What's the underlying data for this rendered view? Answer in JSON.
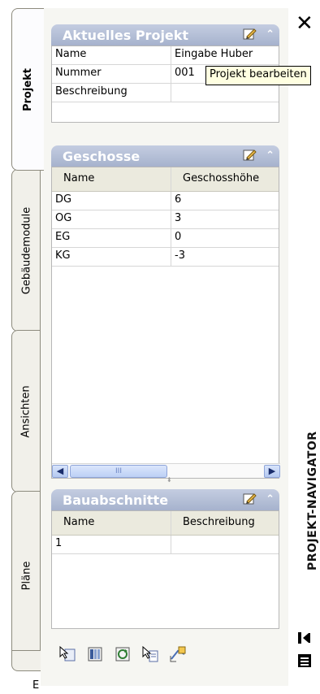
{
  "window": {
    "title": "PROJEKT-NAVIGATOR",
    "close_label": "✕"
  },
  "tabs": [
    {
      "label": "Projekt",
      "active": true
    },
    {
      "label": "Gebäudemodule",
      "active": false
    },
    {
      "label": "Ansichten",
      "active": false
    },
    {
      "label": "Pläne",
      "active": false
    }
  ],
  "bottom_text": "E",
  "tooltip": "Projekt bearbeiten",
  "current_project": {
    "title": "Aktuelles Projekt",
    "rows": [
      {
        "name": "Name",
        "value": "Eingabe Huber"
      },
      {
        "name": "Nummer",
        "value": "001"
      },
      {
        "name": "Beschreibung",
        "value": ""
      }
    ]
  },
  "floors": {
    "title": "Geschosse",
    "columns": [
      "Name",
      "Geschosshöhe"
    ],
    "rows": [
      {
        "name": "DG",
        "value": "6"
      },
      {
        "name": "OG",
        "value": "3"
      },
      {
        "name": "EG",
        "value": "0"
      },
      {
        "name": "KG",
        "value": "-3"
      }
    ],
    "scroll_thumb_label": "III"
  },
  "phases": {
    "title": "Bauabschnitte",
    "columns": [
      "Name",
      "Beschreibung"
    ],
    "rows": [
      {
        "name": "1",
        "value": ""
      }
    ]
  },
  "colors": {
    "section_header": "#a6b2cd",
    "tooltip_bg": "#ffffe1",
    "panel_bg": "#f6f6f2"
  },
  "toolbar_icons": [
    "select-cursor-icon",
    "grid-icon",
    "refresh-icon",
    "cursor-doc-icon",
    "repath-icon"
  ]
}
